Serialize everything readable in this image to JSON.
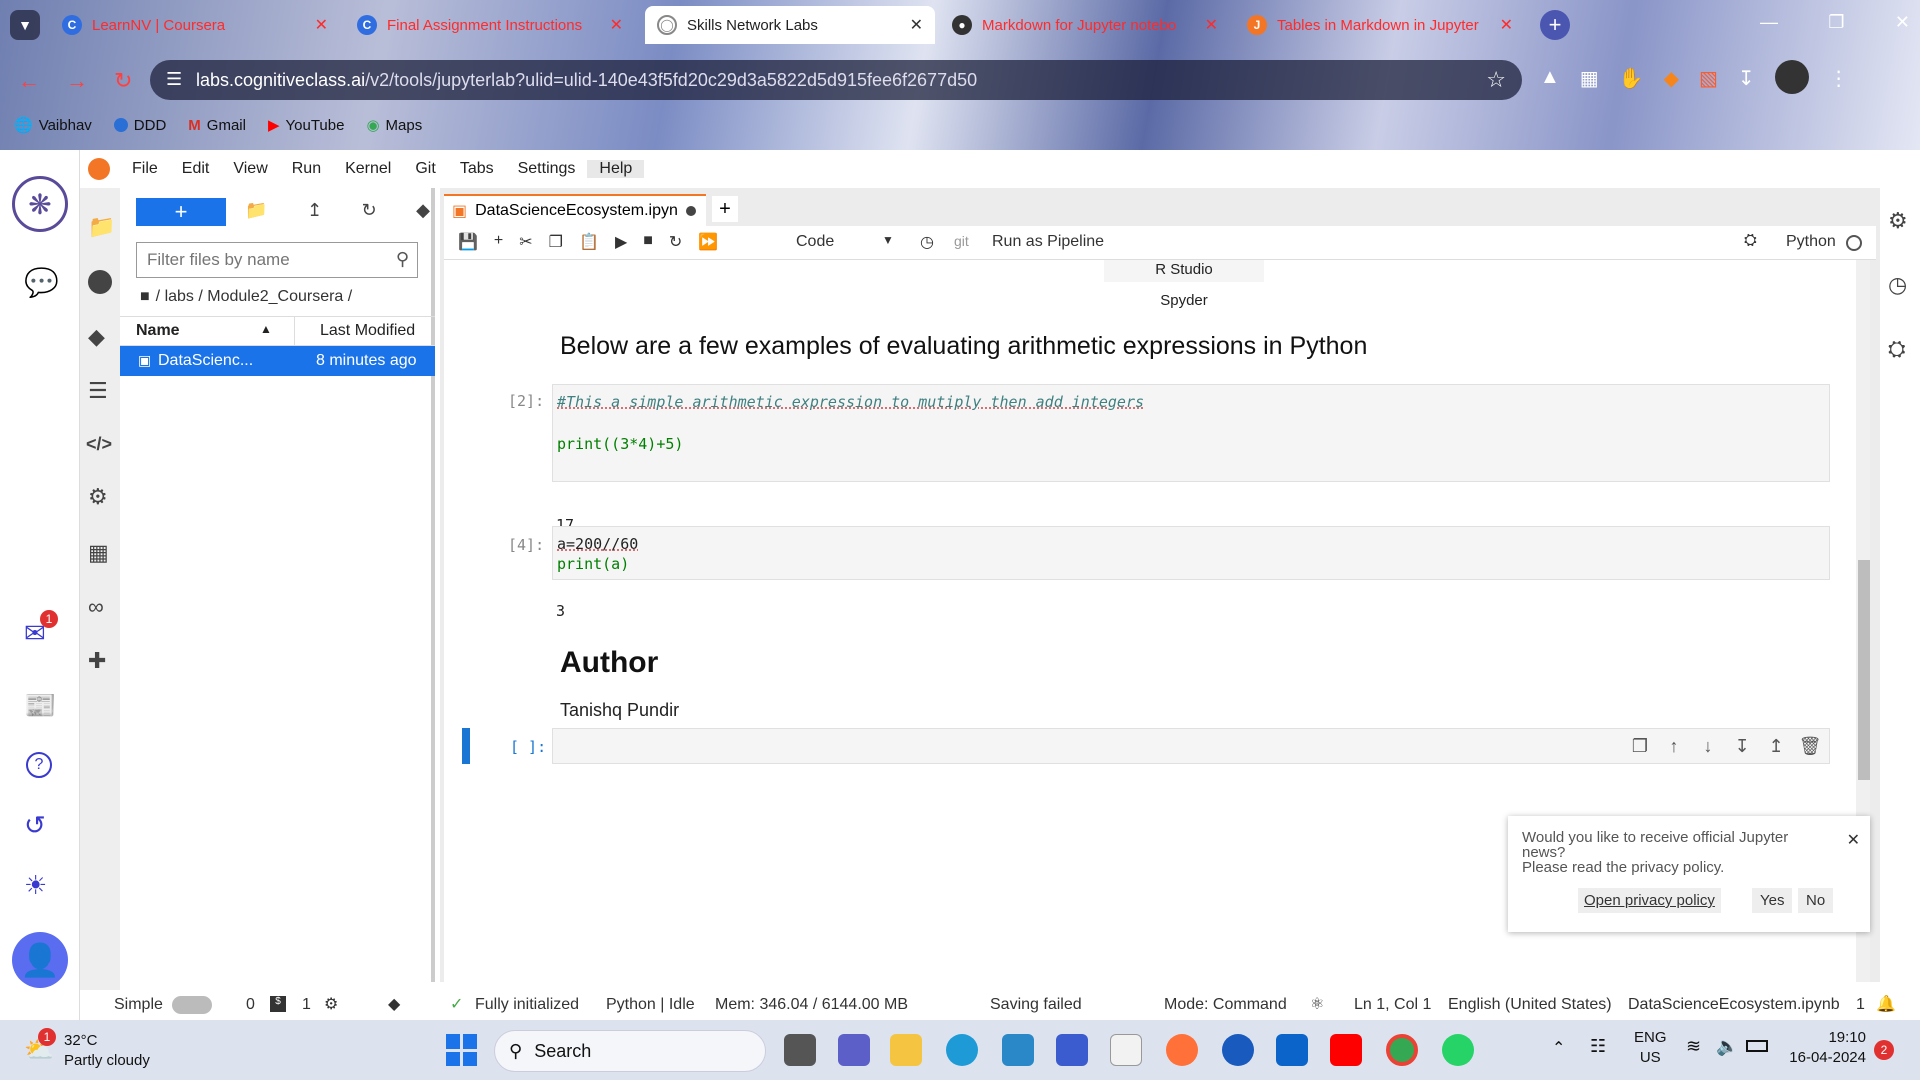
{
  "browser": {
    "tabs": [
      {
        "label": "LearnNV | Coursera",
        "icon": "coursera-icon",
        "active": false
      },
      {
        "label": "Final Assignment Instructions",
        "icon": "coursera-icon",
        "active": false
      },
      {
        "label": "Skills Network Labs",
        "icon": "skills-network-icon",
        "active": true
      },
      {
        "label": "Markdown for Jupyter notebo",
        "icon": "github-icon",
        "active": false
      },
      {
        "label": "Tables in Markdown in Jupyter",
        "icon": "jupyter-icon",
        "active": false
      }
    ],
    "url_host": "labs.cognitiveclass.ai",
    "url_path": "/v2/tools/jupyterlab?ulid=ulid-140e43f5fd20c29d3a5822d5d915fee6f2677d50",
    "bookmarks": [
      "Vaibhav",
      "DDD",
      "Gmail",
      "YouTube",
      "Maps"
    ]
  },
  "menu": [
    "File",
    "Edit",
    "View",
    "Run",
    "Kernel",
    "Git",
    "Tabs",
    "Settings",
    "Help"
  ],
  "filebrowser": {
    "filter_placeholder": "Filter files by name",
    "breadcrumb": "/ labs / Module2_Coursera /",
    "col_name": "Name",
    "col_modified": "Last Modified",
    "files": [
      {
        "name": "DataScienc...",
        "modified": "8 minutes ago"
      }
    ]
  },
  "notebook": {
    "tab_title": "DataScienceEcosystem.ipyn",
    "cell_type": "Code",
    "git_label": "git",
    "pipeline_label": "Run as Pipeline",
    "kernel": "Python",
    "table_rows": [
      "R Studio",
      "Spyder"
    ],
    "heading": "Below are a few examples of evaluating arithmetic expressions in Python",
    "cell1": {
      "prompt": "[2]:",
      "comment": "#This a simple arithmetic expression to mutiply then add integers",
      "code": "print((3*4)+5)",
      "output": "17"
    },
    "cell2": {
      "prompt": "[4]:",
      "line1": "a=200//60",
      "line2": "print(a)",
      "output": "3"
    },
    "author_heading": "Author",
    "author_name": "Tanishq Pundir",
    "empty_prompt": "[ ]:"
  },
  "notification": {
    "line1": "Would you like to receive official Jupyter news?",
    "line2": "Please read the privacy policy.",
    "privacy_link": "Open privacy policy",
    "yes": "Yes",
    "no": "No"
  },
  "statusbar": {
    "mode_simple": "Simple",
    "count0": "0",
    "count1": "1",
    "init": "Fully initialized",
    "kernel_status": "Python | Idle",
    "mem": "Mem: 346.04 / 6144.00 MB",
    "saving": "Saving failed",
    "mode": "Mode: Command",
    "position": "Ln 1, Col 1",
    "language": "English (United States)",
    "filename": "DataScienceEcosystem.ipynb",
    "notif_count": "1"
  },
  "leftbar": {
    "mail_badge": "1"
  },
  "taskbar": {
    "weather_temp": "32°C",
    "weather_desc": "Partly cloudy",
    "weather_badge": "1",
    "search": "Search",
    "lang": "ENG",
    "region": "US",
    "time": "19:10",
    "date": "16-04-2024",
    "notif_badge": "2"
  }
}
